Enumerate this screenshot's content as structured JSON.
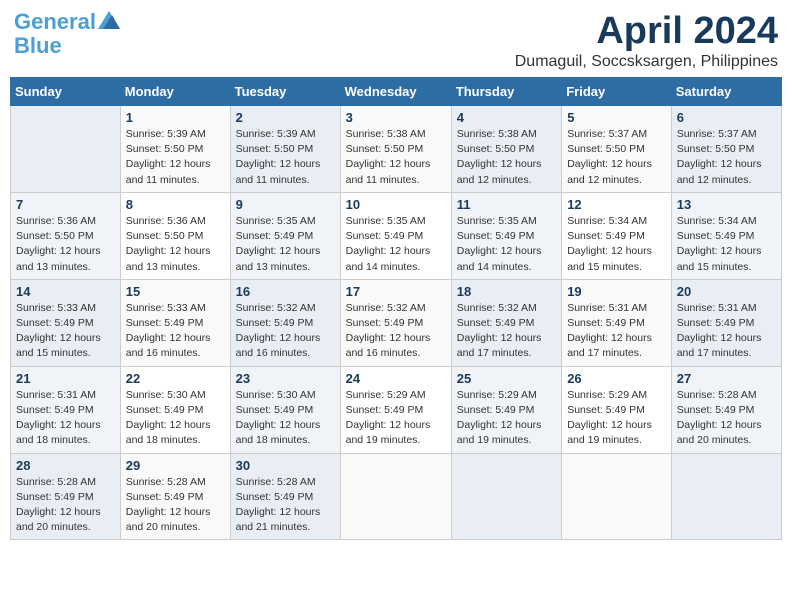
{
  "header": {
    "logo_line1": "General",
    "logo_line2": "Blue",
    "title": "April 2024",
    "subtitle": "Dumaguil, Soccsksargen, Philippines"
  },
  "days_of_week": [
    "Sunday",
    "Monday",
    "Tuesday",
    "Wednesday",
    "Thursday",
    "Friday",
    "Saturday"
  ],
  "weeks": [
    [
      {
        "day": "",
        "info": ""
      },
      {
        "day": "1",
        "info": "Sunrise: 5:39 AM\nSunset: 5:50 PM\nDaylight: 12 hours\nand 11 minutes."
      },
      {
        "day": "2",
        "info": "Sunrise: 5:39 AM\nSunset: 5:50 PM\nDaylight: 12 hours\nand 11 minutes."
      },
      {
        "day": "3",
        "info": "Sunrise: 5:38 AM\nSunset: 5:50 PM\nDaylight: 12 hours\nand 11 minutes."
      },
      {
        "day": "4",
        "info": "Sunrise: 5:38 AM\nSunset: 5:50 PM\nDaylight: 12 hours\nand 12 minutes."
      },
      {
        "day": "5",
        "info": "Sunrise: 5:37 AM\nSunset: 5:50 PM\nDaylight: 12 hours\nand 12 minutes."
      },
      {
        "day": "6",
        "info": "Sunrise: 5:37 AM\nSunset: 5:50 PM\nDaylight: 12 hours\nand 12 minutes."
      }
    ],
    [
      {
        "day": "7",
        "info": "Sunrise: 5:36 AM\nSunset: 5:50 PM\nDaylight: 12 hours\nand 13 minutes."
      },
      {
        "day": "8",
        "info": "Sunrise: 5:36 AM\nSunset: 5:50 PM\nDaylight: 12 hours\nand 13 minutes."
      },
      {
        "day": "9",
        "info": "Sunrise: 5:35 AM\nSunset: 5:49 PM\nDaylight: 12 hours\nand 13 minutes."
      },
      {
        "day": "10",
        "info": "Sunrise: 5:35 AM\nSunset: 5:49 PM\nDaylight: 12 hours\nand 14 minutes."
      },
      {
        "day": "11",
        "info": "Sunrise: 5:35 AM\nSunset: 5:49 PM\nDaylight: 12 hours\nand 14 minutes."
      },
      {
        "day": "12",
        "info": "Sunrise: 5:34 AM\nSunset: 5:49 PM\nDaylight: 12 hours\nand 15 minutes."
      },
      {
        "day": "13",
        "info": "Sunrise: 5:34 AM\nSunset: 5:49 PM\nDaylight: 12 hours\nand 15 minutes."
      }
    ],
    [
      {
        "day": "14",
        "info": "Sunrise: 5:33 AM\nSunset: 5:49 PM\nDaylight: 12 hours\nand 15 minutes."
      },
      {
        "day": "15",
        "info": "Sunrise: 5:33 AM\nSunset: 5:49 PM\nDaylight: 12 hours\nand 16 minutes."
      },
      {
        "day": "16",
        "info": "Sunrise: 5:32 AM\nSunset: 5:49 PM\nDaylight: 12 hours\nand 16 minutes."
      },
      {
        "day": "17",
        "info": "Sunrise: 5:32 AM\nSunset: 5:49 PM\nDaylight: 12 hours\nand 16 minutes."
      },
      {
        "day": "18",
        "info": "Sunrise: 5:32 AM\nSunset: 5:49 PM\nDaylight: 12 hours\nand 17 minutes."
      },
      {
        "day": "19",
        "info": "Sunrise: 5:31 AM\nSunset: 5:49 PM\nDaylight: 12 hours\nand 17 minutes."
      },
      {
        "day": "20",
        "info": "Sunrise: 5:31 AM\nSunset: 5:49 PM\nDaylight: 12 hours\nand 17 minutes."
      }
    ],
    [
      {
        "day": "21",
        "info": "Sunrise: 5:31 AM\nSunset: 5:49 PM\nDaylight: 12 hours\nand 18 minutes."
      },
      {
        "day": "22",
        "info": "Sunrise: 5:30 AM\nSunset: 5:49 PM\nDaylight: 12 hours\nand 18 minutes."
      },
      {
        "day": "23",
        "info": "Sunrise: 5:30 AM\nSunset: 5:49 PM\nDaylight: 12 hours\nand 18 minutes."
      },
      {
        "day": "24",
        "info": "Sunrise: 5:29 AM\nSunset: 5:49 PM\nDaylight: 12 hours\nand 19 minutes."
      },
      {
        "day": "25",
        "info": "Sunrise: 5:29 AM\nSunset: 5:49 PM\nDaylight: 12 hours\nand 19 minutes."
      },
      {
        "day": "26",
        "info": "Sunrise: 5:29 AM\nSunset: 5:49 PM\nDaylight: 12 hours\nand 19 minutes."
      },
      {
        "day": "27",
        "info": "Sunrise: 5:28 AM\nSunset: 5:49 PM\nDaylight: 12 hours\nand 20 minutes."
      }
    ],
    [
      {
        "day": "28",
        "info": "Sunrise: 5:28 AM\nSunset: 5:49 PM\nDaylight: 12 hours\nand 20 minutes."
      },
      {
        "day": "29",
        "info": "Sunrise: 5:28 AM\nSunset: 5:49 PM\nDaylight: 12 hours\nand 20 minutes."
      },
      {
        "day": "30",
        "info": "Sunrise: 5:28 AM\nSunset: 5:49 PM\nDaylight: 12 hours\nand 21 minutes."
      },
      {
        "day": "",
        "info": ""
      },
      {
        "day": "",
        "info": ""
      },
      {
        "day": "",
        "info": ""
      },
      {
        "day": "",
        "info": ""
      }
    ]
  ]
}
